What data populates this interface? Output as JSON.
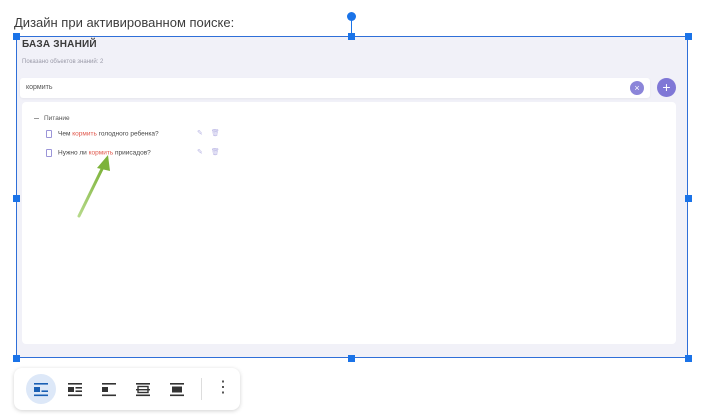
{
  "caption": "Дизайн при активированном поиске:",
  "knowledge_base": {
    "title": "БАЗА ЗНАНИЙ",
    "count_text": "Показано объектов знаний: 2",
    "search_value": "кормить",
    "clear_symbol": "×",
    "add_symbol": "+",
    "group_name": "Питание",
    "items": [
      {
        "before": "Чем ",
        "highlight": "кормить",
        "after": " голодного ребенка?"
      },
      {
        "before": "Нужно ли ",
        "highlight": "кормить",
        "after": " приисадов?"
      }
    ]
  },
  "toolbar": {
    "more_symbol": "⋮"
  },
  "colors": {
    "selection": "#1a73e8",
    "accent": "#7f77d6",
    "highlight": "#e0564a",
    "arrow": "#8ec24a"
  }
}
